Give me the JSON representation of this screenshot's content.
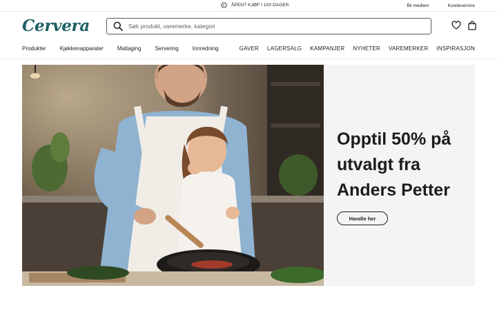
{
  "topbar": {
    "promo_text": "ÅPENT KJØP I 100 DAGER",
    "links": [
      "Bli medlem",
      "Kundeservice"
    ]
  },
  "header": {
    "logo_text": "Cervera",
    "search_placeholder": "Søk produkt, varemerke, kategori"
  },
  "nav": {
    "left": [
      "Produkter",
      "Kjøkkenapparater",
      "Matlaging",
      "Servering",
      "Innredning"
    ],
    "right": [
      "GAVER",
      "LAGERSALG",
      "KAMPANJER",
      "NYHETER",
      "VAREMERKER",
      "INSPIRASJON"
    ]
  },
  "hero": {
    "title": "Opptil 50% på utvalgt fra Anders Petter",
    "cta_label": "Handle her"
  },
  "colors": {
    "brand": "#1f6063",
    "text": "#1c1c1c",
    "hero_panel": "#f4f4f4"
  },
  "icons": [
    "return-icon",
    "search-icon",
    "heart-icon",
    "shopping-bag-icon"
  ]
}
